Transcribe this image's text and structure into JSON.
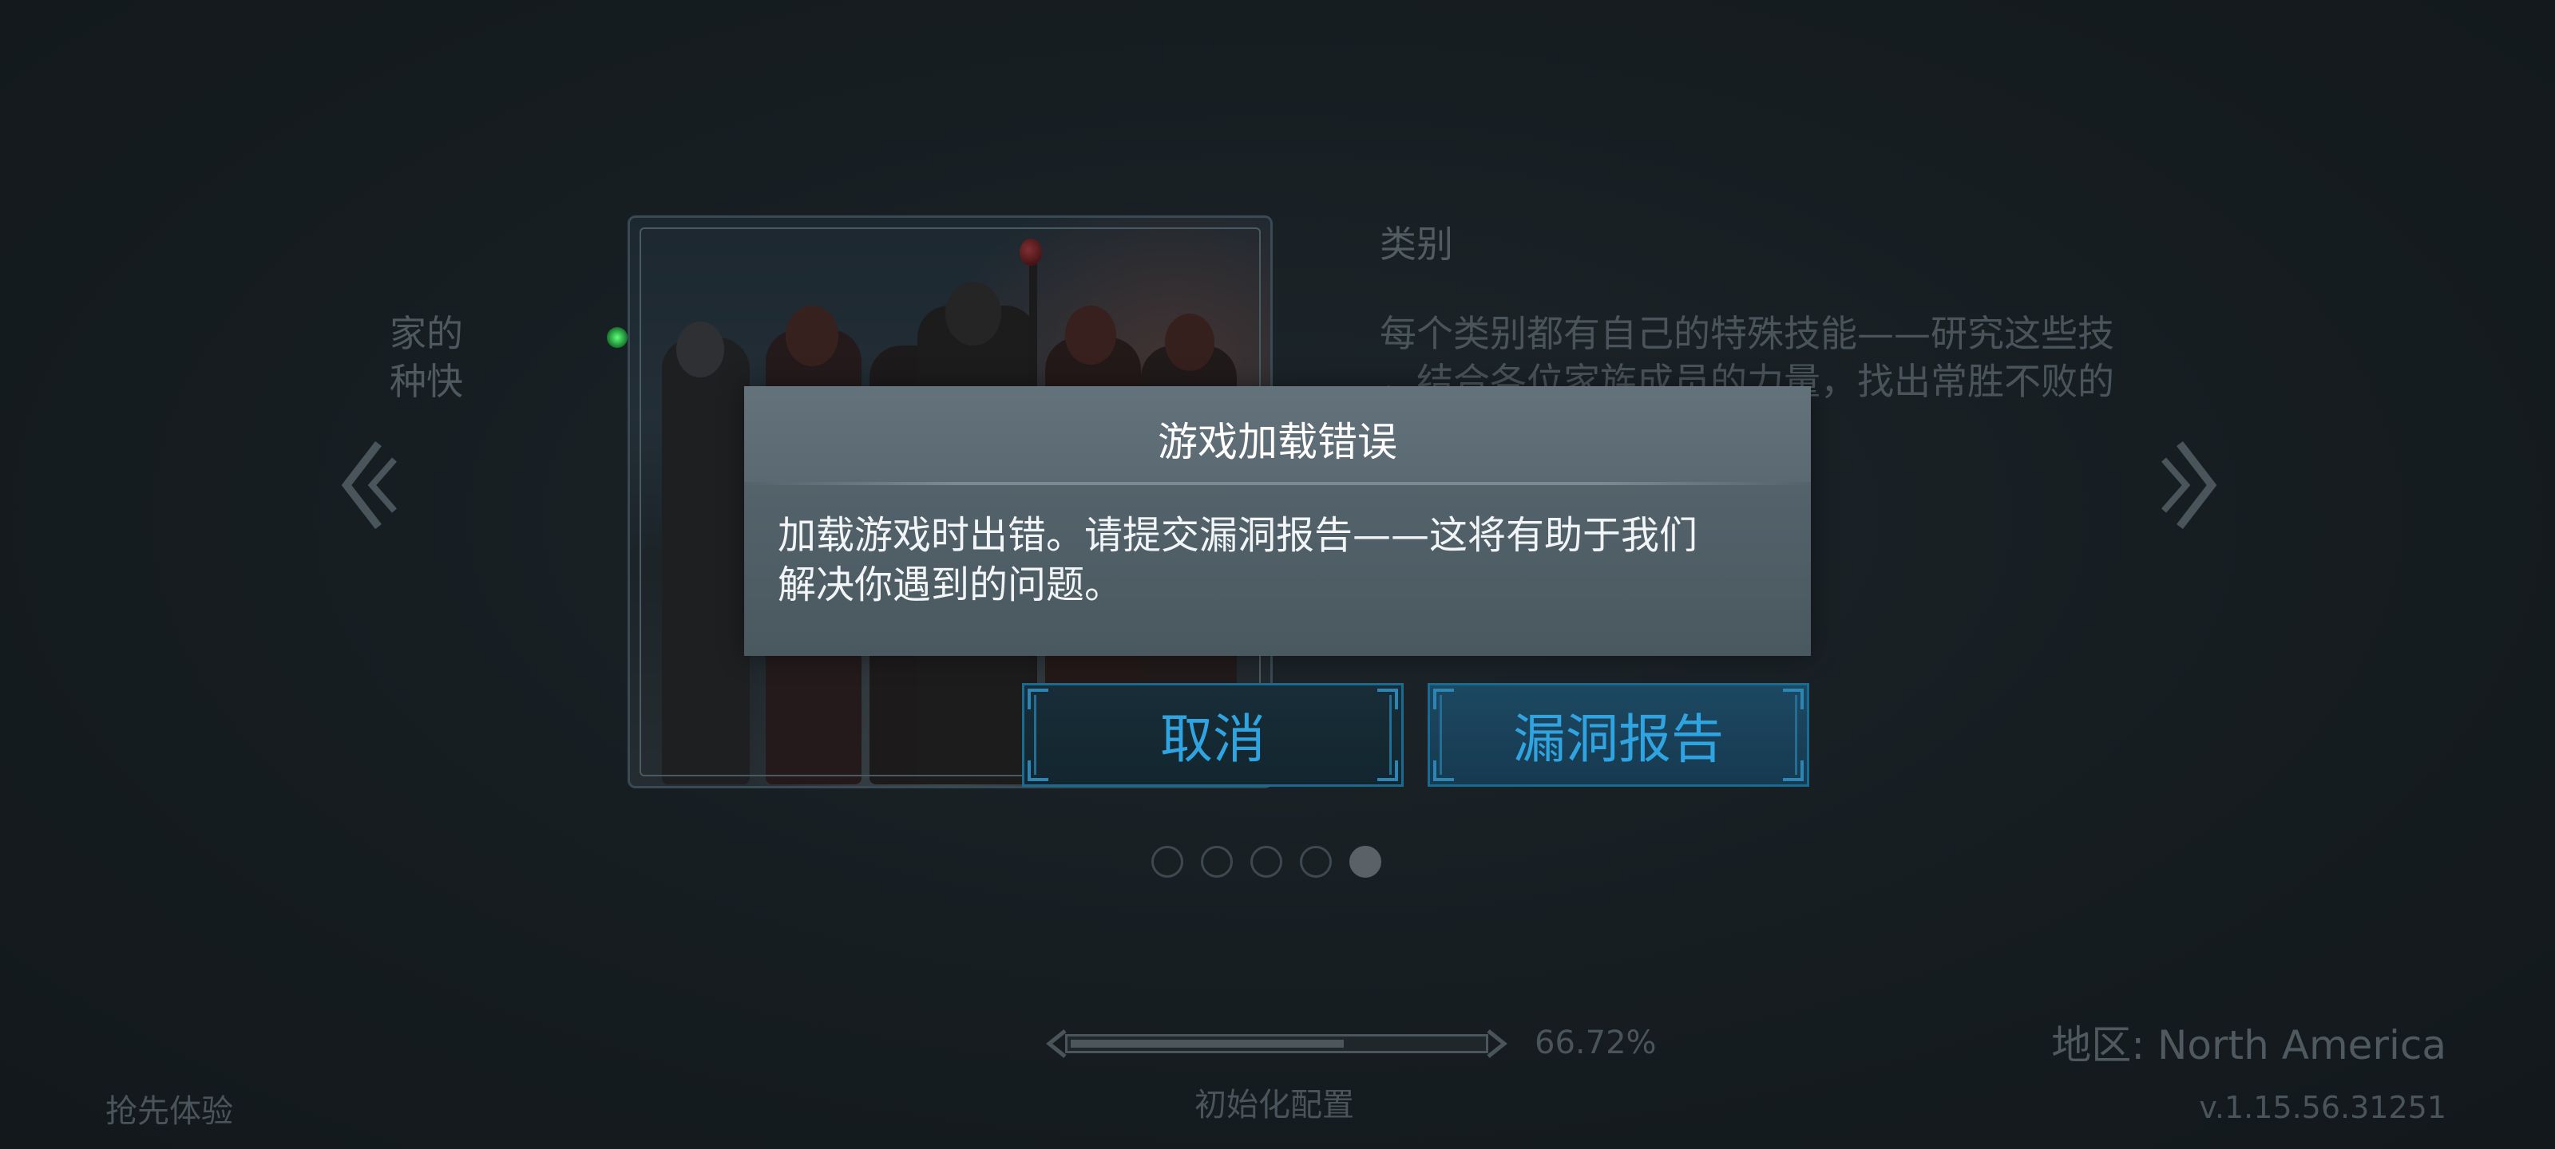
{
  "carousel": {
    "left_partial_text": [
      "家的",
      "种快"
    ],
    "category_title": "类别",
    "category_desc": [
      "每个类别都有自己的特殊技能——研究这些技",
      "，结合各位家族成员的力量，找出常胜不败的"
    ],
    "page_count": 5,
    "active_page": 5
  },
  "modal": {
    "title": "游戏加载错误",
    "message_line1": "加载游戏时出错。请提交漏洞报告——这将有助于我们",
    "message_line2": "解决你遇到的问题。",
    "cancel_label": "取消",
    "report_label": "漏洞报告"
  },
  "loading": {
    "progress_percent": 66.72,
    "progress_label": "66.72%",
    "status_text": "初始化配置"
  },
  "footer": {
    "early_access": "抢先体验",
    "region": "地区: North America",
    "version": "v.1.15.56.31251"
  },
  "colors": {
    "background": "#161d21",
    "modal_bg": "#55646c",
    "button_text": "#2fa4e0",
    "button_border": "#1b6b90"
  }
}
